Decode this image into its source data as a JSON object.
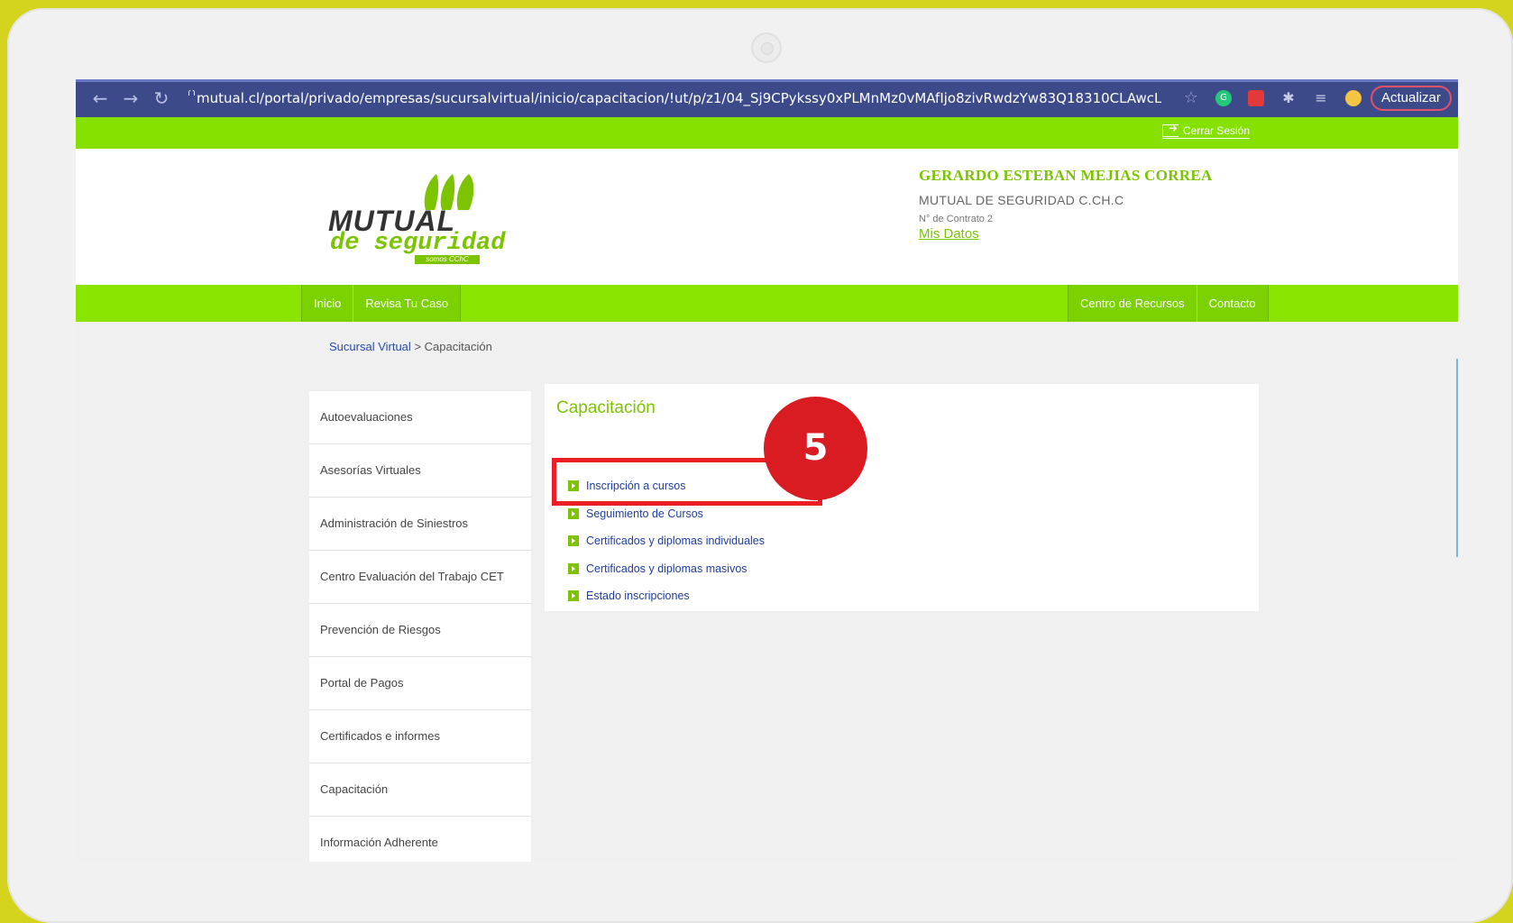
{
  "browser": {
    "url": "mutual.cl/portal/privado/empresas/sucursalvirtual/inicio/capacitacion/!ut/p/z1/04_Sj9CPykssy0xPLMnMz0vMAfIjo8zivRwdzYw83Q18310CLAwcLcOM...",
    "update_label": "Actualizar"
  },
  "top_strip": {
    "logout_label": "Cerrar Sesión"
  },
  "logo": {
    "main": "MUTUAL",
    "sub": "de seguridad",
    "tag": "somos CChC"
  },
  "user": {
    "name": "GERARDO ESTEBAN MEJIAS CORREA",
    "company": "MUTUAL DE SEGURIDAD C.CH.C",
    "contract": "N° de Contrato 2",
    "my_data": "Mis Datos"
  },
  "nav": {
    "left": [
      "Inicio",
      "Revisa Tu Caso"
    ],
    "right": [
      "Centro de Recursos",
      "Contacto"
    ]
  },
  "breadcrumb": {
    "link": "Sucursal Virtual",
    "separator": ">",
    "current": "Capacitación"
  },
  "sidebar": {
    "items": [
      "Autoevaluaciones",
      "Asesorías Virtuales",
      "Administración de Siniestros",
      "Centro Evaluación del Trabajo CET",
      "Prevención de Riesgos",
      "Portal de Pagos",
      "Certificados e informes",
      "Capacitación",
      "Información Adherente"
    ]
  },
  "card": {
    "title": "Capacitación",
    "links": [
      "Inscripción a cursos",
      "Seguimiento de Cursos",
      "Certificados y diplomas individuales",
      "Certificados y diplomas masivos",
      "Estado inscripciones"
    ]
  },
  "annotation": {
    "step": "5",
    "color": "#d91c22"
  },
  "colors": {
    "brand_green": "#7cc400",
    "nav_green": "#8ae500",
    "link_blue": "#1f3d9c"
  }
}
